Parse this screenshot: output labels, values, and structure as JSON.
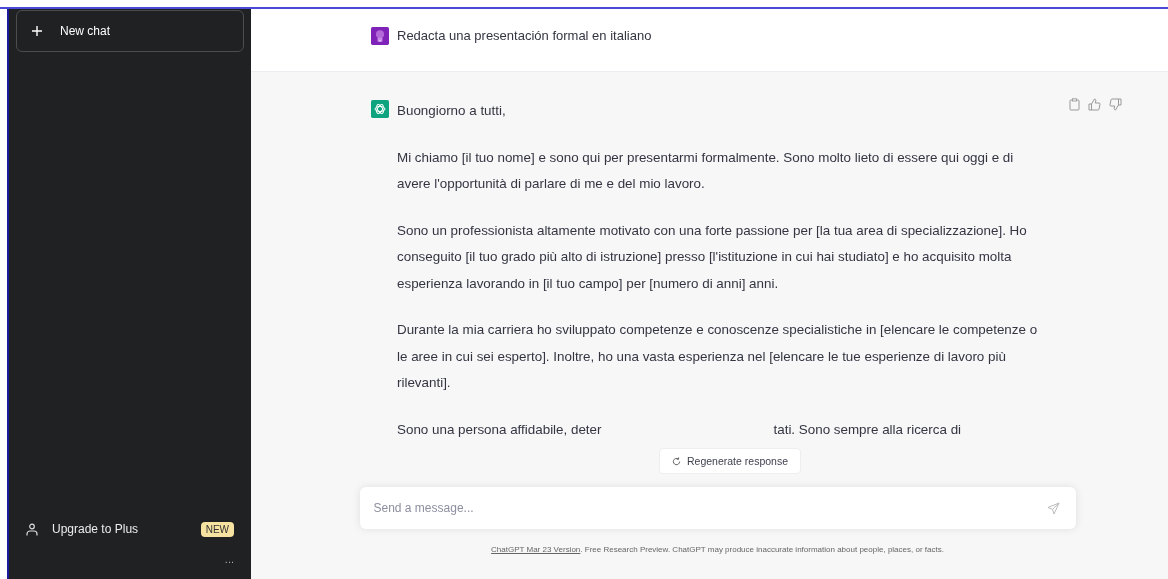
{
  "sidebar": {
    "new_chat": "New chat",
    "upgrade": {
      "label": "Upgrade to Plus",
      "badge": "NEW"
    },
    "more": "..."
  },
  "conversation": {
    "user_message": "Redacta una presentación formal en italiano",
    "assistant_paragraphs": [
      "Buongiorno a tutti,",
      "Mi chiamo [il tuo nome] e sono qui per presentarmi formalmente. Sono molto lieto di essere qui oggi e di avere l'opportunità di parlare di me e del mio lavoro.",
      "Sono un professionista altamente motivato con una forte passione per [la tua area di specializzazione]. Ho conseguito [il tuo grado più alto di istruzione] presso [l'istituzione in cui hai studiato] e ho acquisito molta esperienza lavorando in [il tuo campo] per [numero di anni] anni.",
      "Durante la mia carriera ho sviluppato competenze e conoscenze specialistiche in [elencare le competenze o le aree in cui sei esperto]. Inoltre, ho una vasta esperienza nel [elencare le tue esperienze di lavoro più rilevanti]."
    ],
    "partial_paragraph": {
      "before": "Sono una persona affidabile, deter",
      "after": "tati. Sono sempre alla ricerca di"
    }
  },
  "regenerate_button": "Regenerate response",
  "composer": {
    "placeholder": "Send a message..."
  },
  "footer": {
    "link": "ChatGPT Mar 23 Version",
    "text": ". Free Research Preview. ChatGPT may produce inaccurate information about people, places, or facts."
  }
}
